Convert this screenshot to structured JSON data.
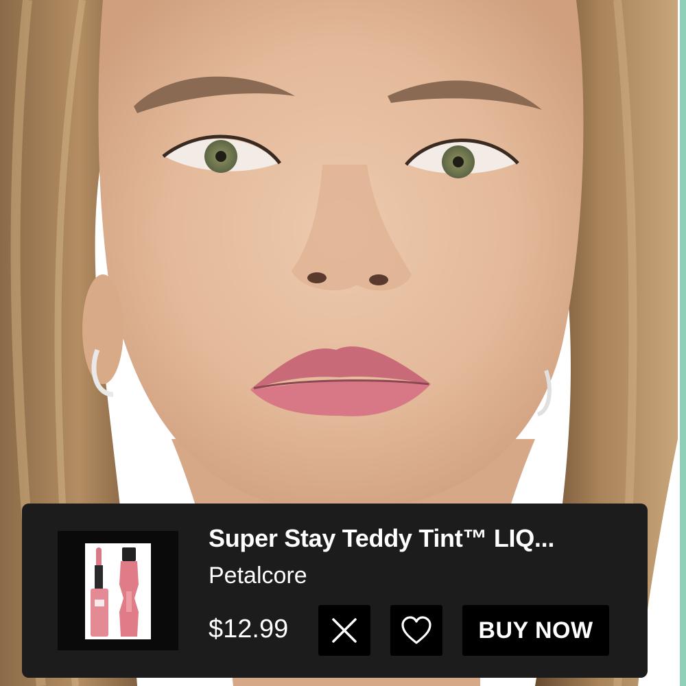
{
  "product": {
    "name": "Super Stay Teddy Tint™ LIQ...",
    "shade": "Petalcore",
    "price": "$12.99"
  },
  "actions": {
    "close_icon": "close-icon",
    "favorite_icon": "heart-icon",
    "buy_label": "BUY NOW"
  },
  "colors": {
    "card_background": "#1c1c1c",
    "button_background": "#000000",
    "text": "#ffffff",
    "lip_color": "#d87886",
    "accent_strip": "#8fd0b8"
  }
}
